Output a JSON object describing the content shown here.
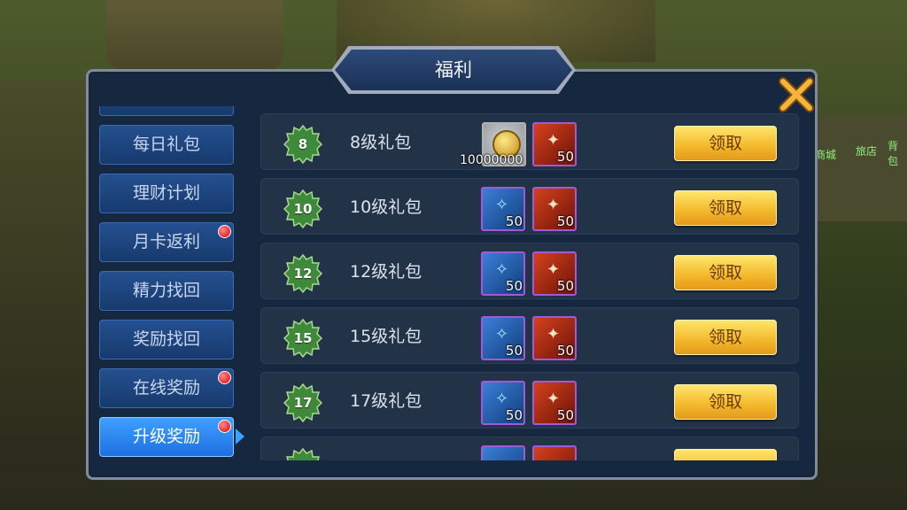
{
  "window": {
    "title": "福利"
  },
  "background": {
    "right_labels": [
      "商城",
      "旅店",
      "背包"
    ]
  },
  "sidebar": {
    "items": [
      {
        "label": "每日礼包",
        "notify": false,
        "active": false
      },
      {
        "label": "理财计划",
        "notify": false,
        "active": false
      },
      {
        "label": "月卡返利",
        "notify": true,
        "active": false
      },
      {
        "label": "精力找回",
        "notify": false,
        "active": false
      },
      {
        "label": "奖励找回",
        "notify": false,
        "active": false
      },
      {
        "label": "在线奖励",
        "notify": true,
        "active": false
      },
      {
        "label": "升级奖励",
        "notify": true,
        "active": true
      }
    ]
  },
  "rewards": [
    {
      "level": "8",
      "name": "8级礼包",
      "item1": {
        "icon": "gold-coin-icon",
        "count": "10000000"
      },
      "item2": {
        "icon": "red-scroll-icon",
        "count": "50"
      },
      "button": "领取"
    },
    {
      "level": "10",
      "name": "10级礼包",
      "item1": {
        "icon": "blue-scroll-icon",
        "count": "50"
      },
      "item2": {
        "icon": "red-scroll-icon",
        "count": "50"
      },
      "button": "领取"
    },
    {
      "level": "12",
      "name": "12级礼包",
      "item1": {
        "icon": "blue-scroll-icon",
        "count": "50"
      },
      "item2": {
        "icon": "red-scroll-icon",
        "count": "50"
      },
      "button": "领取"
    },
    {
      "level": "15",
      "name": "15级礼包",
      "item1": {
        "icon": "blue-scroll-icon",
        "count": "50"
      },
      "item2": {
        "icon": "red-scroll-icon",
        "count": "50"
      },
      "button": "领取"
    },
    {
      "level": "17",
      "name": "17级礼包",
      "item1": {
        "icon": "blue-scroll-icon",
        "count": "50"
      },
      "item2": {
        "icon": "red-scroll-icon",
        "count": "50"
      },
      "button": "领取"
    }
  ],
  "colors": {
    "accent": "#3fa0ff",
    "claim_button": "#f3b72a",
    "panel": "#16283f",
    "badge": "#3f8a3a"
  }
}
